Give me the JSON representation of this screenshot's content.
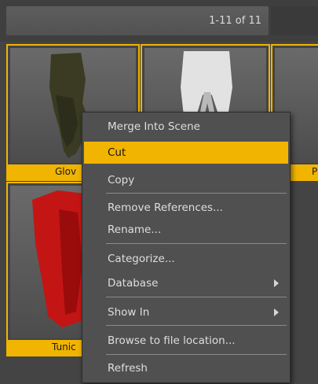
{
  "header": {
    "page_count": "1-11 of 11"
  },
  "tiles": [
    {
      "label": "Glov"
    },
    {
      "label": ""
    },
    {
      "label": "P"
    },
    {
      "label": "Tunic"
    }
  ],
  "context_menu": {
    "items": [
      {
        "label": "Merge Into Scene"
      },
      {
        "label": "Cut"
      },
      {
        "label": "Copy"
      },
      {
        "label": "Remove References..."
      },
      {
        "label": "Rename..."
      },
      {
        "label": "Categorize..."
      },
      {
        "label": "Database"
      },
      {
        "label": "Show In"
      },
      {
        "label": "Browse to file location..."
      },
      {
        "label": "Refresh"
      }
    ],
    "highlighted_item": "Cut"
  },
  "icons": {
    "submenu_arrow": "chevron-right-icon"
  },
  "colors": {
    "accent": "#f1b400",
    "background": "#4a4a4a",
    "menu_background": "#505050",
    "menu_text": "#dedede"
  }
}
